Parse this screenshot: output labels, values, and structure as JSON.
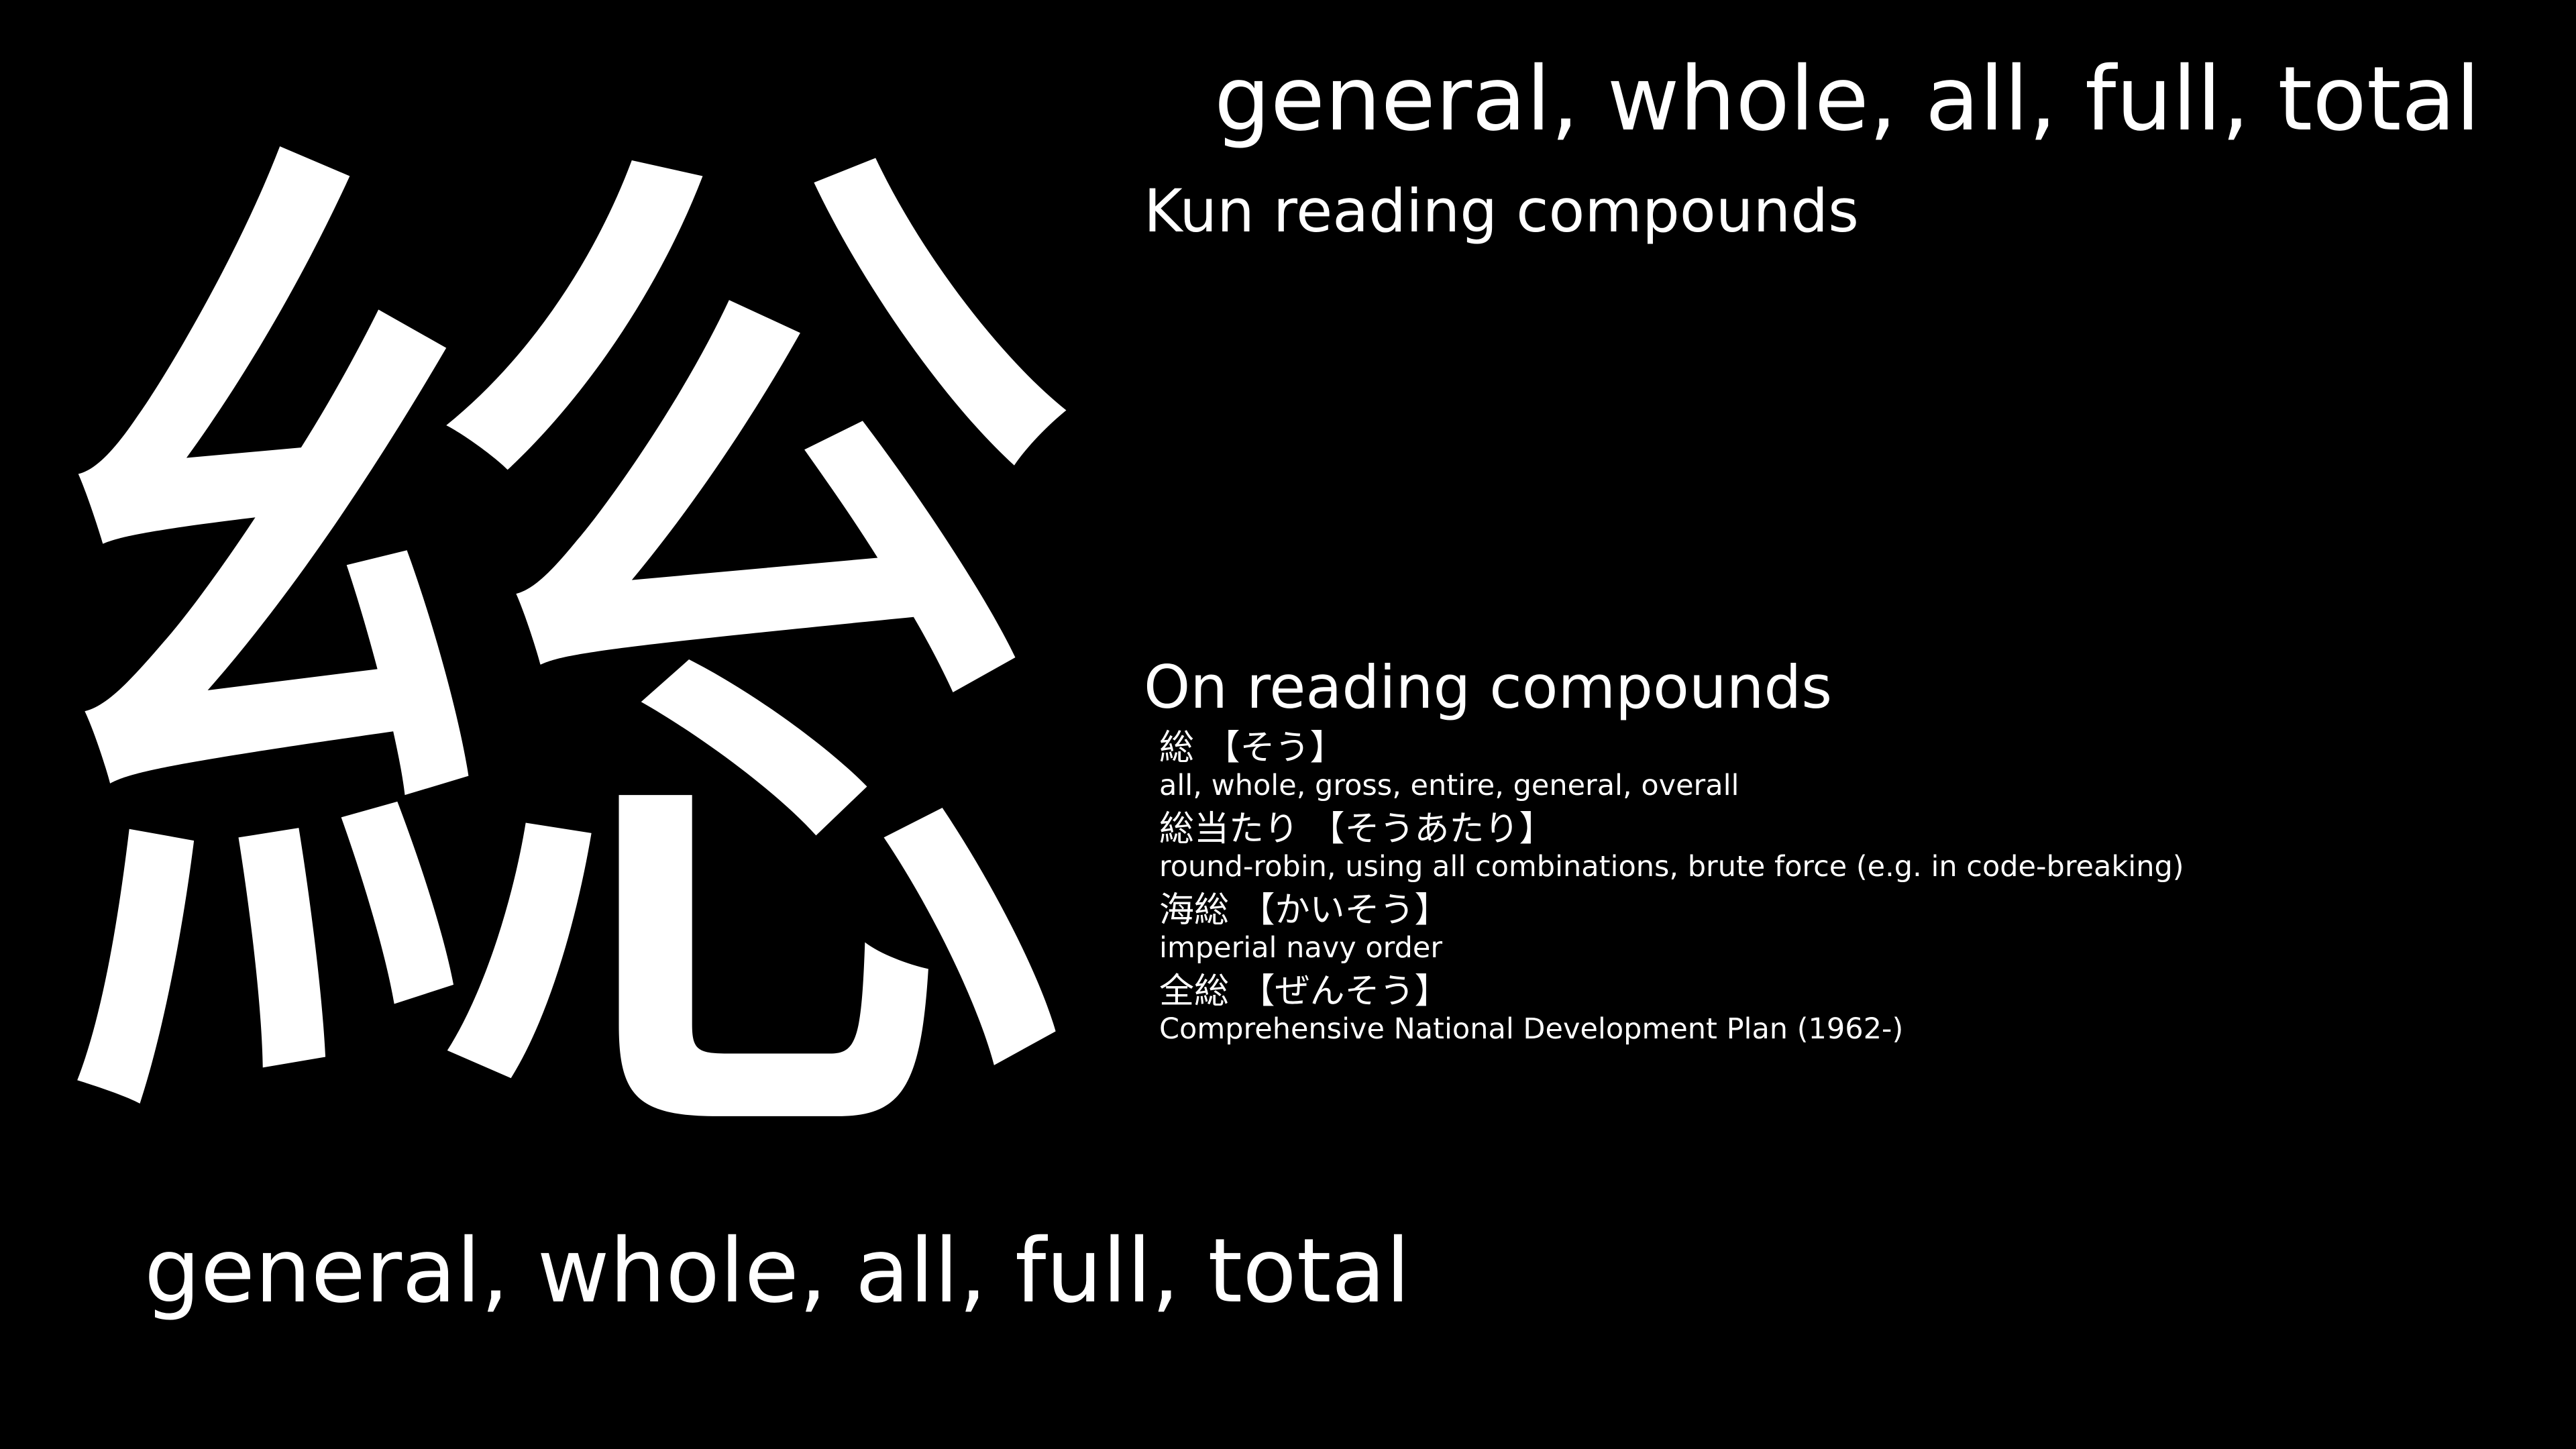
{
  "kanji": "総",
  "meaning": "general, whole, all, full, total",
  "kun_heading": "Kun reading compounds",
  "on_heading": "On reading compounds",
  "on_compounds": [
    {
      "word": "総 【そう】",
      "gloss": "all, whole, gross, entire, general, overall"
    },
    {
      "word": "総当たり 【そうあたり】",
      "gloss": "round-robin, using all combinations, brute force (e.g. in code-breaking)"
    },
    {
      "word": "海総 【かいそう】",
      "gloss": "imperial navy order"
    },
    {
      "word": "全総 【ぜんそう】",
      "gloss": "Comprehensive National Development Plan (1962-)"
    }
  ],
  "colors": {
    "background": "#000000",
    "text": "#ffffff"
  }
}
